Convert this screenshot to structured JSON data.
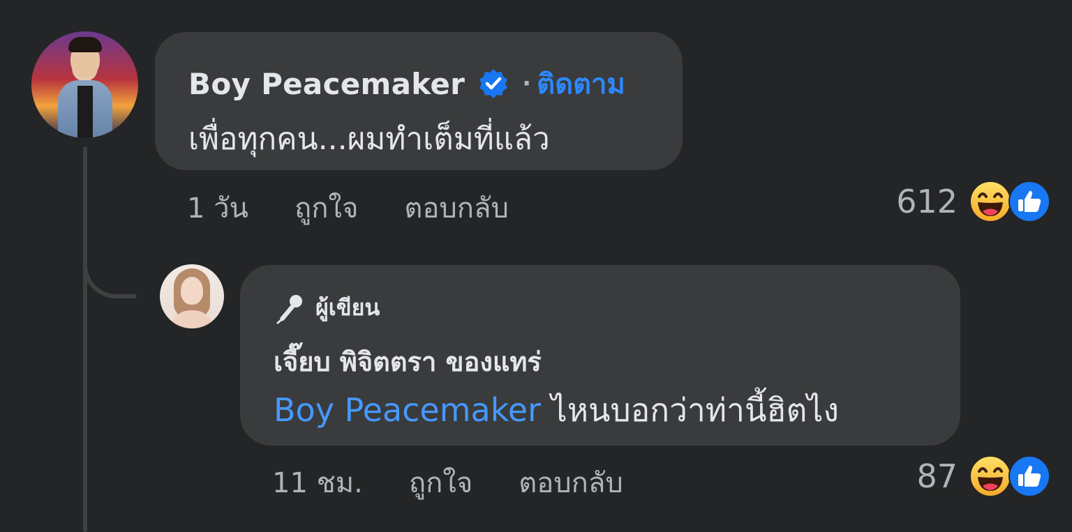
{
  "comment": {
    "author": "Boy Peacemaker",
    "separator": "·",
    "follow_label": "ติดตาม",
    "text": "เพื่อทุกคน...ผมทำเต็มที่แล้ว",
    "time": "1 วัน",
    "like_label": "ถูกใจ",
    "reply_label": "ตอบกลับ",
    "reaction_count": "612",
    "reactions": [
      "haha-icon",
      "like-icon"
    ]
  },
  "reply": {
    "badge_label": "ผู้เขียน",
    "author": "เจี๊ยบ พิจิตตรา ของแทร่",
    "mention": "Boy Peacemaker",
    "text": " ไหนบอกว่าท่านี้ฮิตไง",
    "time": "11 ชม.",
    "like_label": "ถูกใจ",
    "reply_label": "ตอบกลับ",
    "reaction_count": "87",
    "reactions": [
      "haha-icon",
      "like-icon"
    ]
  },
  "colors": {
    "background": "#242526",
    "bubble": "#3a3b3c",
    "primary_text": "#e4e6eb",
    "secondary_text": "#b0b3b8",
    "link": "#2d88ff",
    "verified": "#1877f2"
  }
}
